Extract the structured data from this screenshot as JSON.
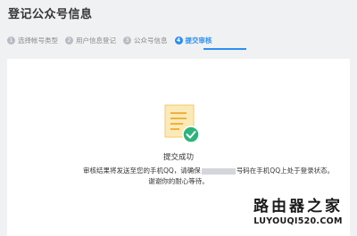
{
  "header": {
    "title": "登记公众号信息"
  },
  "steps": [
    {
      "num": "1",
      "label": "选择帐号类型"
    },
    {
      "num": "2",
      "label": "用户信息登记"
    },
    {
      "num": "3",
      "label": "公众号信息"
    },
    {
      "num": "4",
      "label": "提交审核"
    }
  ],
  "result": {
    "title": "提交成功",
    "message_prefix": "审核结果将发送至您的手机QQ，请确保",
    "message_suffix": "号码在手机QQ上处于登录状态。",
    "message_line2": "谢谢你的耐心等待。"
  },
  "watermark": {
    "cn": "路由器之家",
    "en": "LUYOUQI520.COM"
  },
  "icons": {
    "document": "document-icon",
    "check": "check-circle-icon"
  },
  "colors": {
    "accent": "#2c8ff0",
    "success": "#2cb47c",
    "doc": "#fbe9b8",
    "doc_lines": "#f0b13c"
  }
}
